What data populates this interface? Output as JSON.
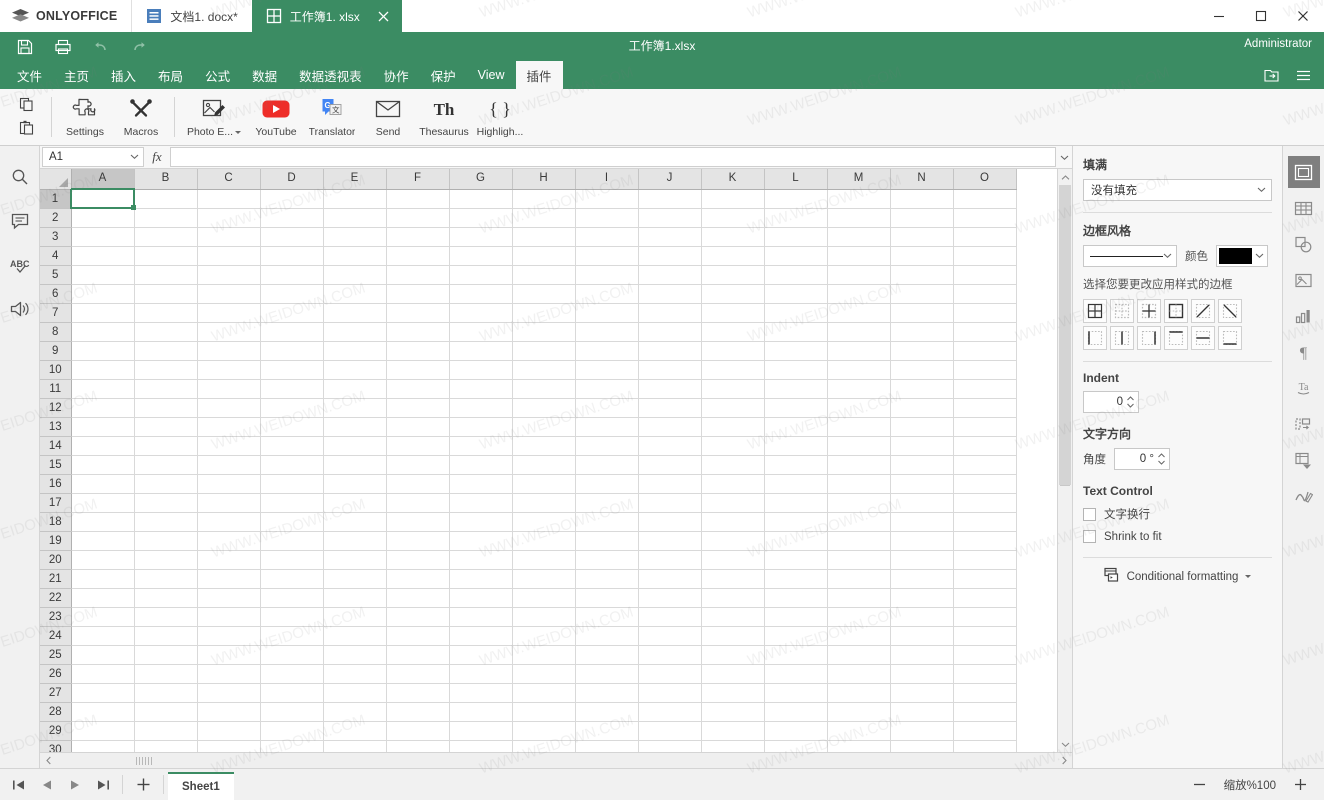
{
  "app": {
    "brand": "ONLYOFFICE",
    "user": "Administrator",
    "doc_title": "工作簿1.xlsx"
  },
  "titlebar": {
    "tabs": [
      {
        "label": "文档1. docx*",
        "icon": "document-icon",
        "active": false
      },
      {
        "label": "工作簿1. xlsx",
        "icon": "spreadsheet-icon",
        "active": true
      }
    ],
    "close_tab": "✕",
    "window": {
      "minimize": "minimize-icon",
      "maximize": "maximize-icon",
      "close": "close-icon"
    }
  },
  "quickbar": {
    "items": [
      {
        "name": "save-button",
        "icon": "save-icon"
      },
      {
        "name": "print-button",
        "icon": "print-icon"
      },
      {
        "name": "undo-button",
        "icon": "undo-icon"
      },
      {
        "name": "redo-button",
        "icon": "redo-icon"
      }
    ]
  },
  "menubar": {
    "items": [
      {
        "label": "文件",
        "active": false
      },
      {
        "label": "主页",
        "active": false
      },
      {
        "label": "插入",
        "active": false
      },
      {
        "label": "布局",
        "active": false
      },
      {
        "label": "公式",
        "active": false
      },
      {
        "label": "数据",
        "active": false
      },
      {
        "label": "数据透视表",
        "active": false
      },
      {
        "label": "协作",
        "active": false
      },
      {
        "label": "保护",
        "active": false
      },
      {
        "label": "View",
        "active": false
      },
      {
        "label": "插件",
        "active": true
      }
    ],
    "right_icons": [
      {
        "name": "open-file-location-icon"
      },
      {
        "name": "hamburger-menu-icon"
      }
    ]
  },
  "ribbon": {
    "clipboard": [
      {
        "name": "copy-button",
        "icon": "copy-icon"
      },
      {
        "name": "paste-button",
        "icon": "paste-icon"
      }
    ],
    "items": [
      {
        "label": "Settings",
        "icon": "puzzle-icon",
        "caret": false
      },
      {
        "label": "Macros",
        "icon": "tools-icon",
        "caret": false
      },
      {
        "label": "Photo E...",
        "icon": "photo-editor-icon",
        "caret": true
      },
      {
        "label": "YouTube",
        "icon": "youtube-icon",
        "caret": false
      },
      {
        "label": "Translator",
        "icon": "translator-icon",
        "caret": false
      },
      {
        "label": "Send",
        "icon": "envelope-icon",
        "caret": false
      },
      {
        "label": "Thesaurus",
        "icon": "thesaurus-icon",
        "caret": false
      },
      {
        "label": "Highligh...",
        "icon": "braces-icon",
        "caret": false
      }
    ]
  },
  "leftrail": {
    "items": [
      {
        "name": "search-icon"
      },
      {
        "name": "comment-icon"
      },
      {
        "name": "spellcheck-icon"
      },
      {
        "name": "feedback-icon"
      }
    ]
  },
  "formulabar": {
    "namebox_value": "A1",
    "fx_label": "fx",
    "formula_value": ""
  },
  "sheet": {
    "columns": [
      "A",
      "B",
      "C",
      "D",
      "E",
      "F",
      "G",
      "H",
      "I",
      "J",
      "K",
      "L",
      "M",
      "N",
      "O"
    ],
    "rows": [
      1,
      2,
      3,
      4,
      5,
      6,
      7,
      8,
      9,
      10,
      11,
      12,
      13,
      14,
      15,
      16,
      17,
      18,
      19,
      20,
      21,
      22,
      23,
      24,
      25,
      26,
      27,
      28,
      29,
      30
    ],
    "selected_cell": "A1",
    "selected_column": "A",
    "selected_row": 1
  },
  "rightpanel": {
    "fill": {
      "heading": "填满",
      "value": "没有填充"
    },
    "border": {
      "heading": "边框风格",
      "color_label": "颜色",
      "color_value": "#000000",
      "hint": "选择您要更改应用样式的边框",
      "buttons": [
        {
          "name": "border-all-icon"
        },
        {
          "name": "border-none-icon"
        },
        {
          "name": "border-inner-icon"
        },
        {
          "name": "border-outer-icon"
        },
        {
          "name": "border-diagonal-up-icon"
        },
        {
          "name": "border-diagonal-down-icon"
        },
        {
          "name": "border-left-icon"
        },
        {
          "name": "border-inner-vertical-icon"
        },
        {
          "name": "border-right-icon"
        },
        {
          "name": "border-top-icon"
        },
        {
          "name": "border-inner-horizontal-icon"
        },
        {
          "name": "border-bottom-icon"
        }
      ]
    },
    "indent": {
      "heading": "Indent",
      "value": "0"
    },
    "orientation": {
      "heading": "文字方向",
      "label": "角度",
      "value": "0 °"
    },
    "textcontrol": {
      "heading": "Text Control",
      "wrap_label": "文字换行",
      "wrap_checked": false,
      "shrink_label": "Shrink to fit",
      "shrink_checked": false
    },
    "conditional_formatting": {
      "label": "Conditional formatting"
    }
  },
  "rightrail": {
    "items": [
      {
        "name": "cell-settings-icon",
        "active": true
      },
      {
        "name": "table-settings-icon",
        "active": false
      },
      {
        "name": "shape-settings-icon",
        "active": false
      },
      {
        "name": "image-settings-icon",
        "active": false
      },
      {
        "name": "chart-settings-icon",
        "active": false
      },
      {
        "name": "paragraph-settings-icon",
        "active": false
      },
      {
        "name": "text-art-settings-icon",
        "active": false
      },
      {
        "name": "slicer-settings-icon",
        "active": false
      },
      {
        "name": "pivot-settings-icon",
        "active": false
      },
      {
        "name": "signature-settings-icon",
        "active": false
      }
    ]
  },
  "statusbar": {
    "nav": [
      {
        "name": "first-sheet-button"
      },
      {
        "name": "prev-sheet-button"
      },
      {
        "name": "next-sheet-button"
      },
      {
        "name": "last-sheet-button"
      }
    ],
    "add_sheet": "+",
    "sheets": [
      {
        "label": "Sheet1",
        "active": true
      }
    ],
    "zoom_out": "−",
    "zoom_label": "缩放%100",
    "zoom_in": "+"
  },
  "watermark": {
    "text": "WWW.WEIDOWN.COM"
  }
}
